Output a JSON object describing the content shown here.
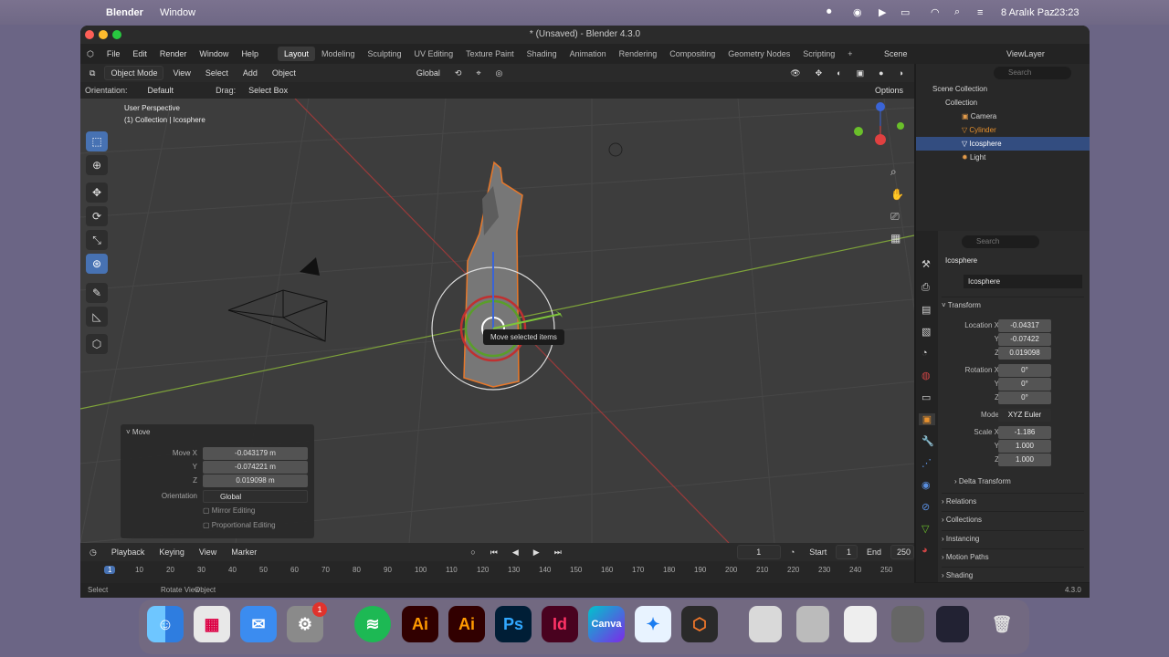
{
  "menubar": {
    "app": "Blender",
    "window": "Window",
    "date": "8 Aralık Paz",
    "time": "23:23"
  },
  "window": {
    "title": "* (Unsaved) - Blender 4.3.0"
  },
  "topmenu": {
    "file": "File",
    "edit": "Edit",
    "render": "Render",
    "window": "Window",
    "help": "Help"
  },
  "workspaces": [
    "Layout",
    "Modeling",
    "Sculpting",
    "UV Editing",
    "Texture Paint",
    "Shading",
    "Animation",
    "Rendering",
    "Compositing",
    "Geometry Nodes",
    "Scripting"
  ],
  "scene": {
    "name": "Scene",
    "viewlayer": "ViewLayer"
  },
  "viewport_header": {
    "mode": "Object Mode",
    "view": "View",
    "select": "Select",
    "add": "Add",
    "object": "Object",
    "transform": "Global"
  },
  "viewport_header2": {
    "orientation_label": "Orientation:",
    "orientation": "Default",
    "drag_label": "Drag:",
    "drag": "Select Box",
    "options": "Options"
  },
  "viewport": {
    "perspective": "User Perspective",
    "collection": "(1) Collection | Icosphere",
    "tooltip": "Move selected items"
  },
  "move_panel": {
    "title": "Move",
    "move_x_label": "Move X",
    "move_x": "-0.043179 m",
    "y_label": "Y",
    "y": "-0.074221 m",
    "z_label": "Z",
    "z": "0.019098 m",
    "orientation_label": "Orientation",
    "orientation": "Global",
    "mirror": "Mirror Editing",
    "proportional": "Proportional Editing"
  },
  "outliner": {
    "search_placeholder": "Search",
    "scene_collection": "Scene Collection",
    "collection": "Collection",
    "items": [
      "Camera",
      "Cylinder",
      "Icosphere",
      "Light"
    ]
  },
  "properties": {
    "search_placeholder": "Search",
    "object_name": "Icosphere",
    "data_name": "Icosphere",
    "transform": "Transform",
    "location_label": "Location X",
    "loc_x": "-0.04317",
    "loc_y": "-0.07422",
    "loc_z": "0.019098",
    "rotation_label": "Rotation X",
    "rot_x": "0°",
    "rot_y": "0°",
    "rot_z": "0°",
    "mode_label": "Mode",
    "mode": "XYZ Euler",
    "scale_label": "Scale X",
    "scale_x": "-1.186",
    "scale_y": "1.000",
    "scale_z": "1.000",
    "y_label": "Y",
    "z_label": "Z",
    "delta": "Delta Transform",
    "relations": "Relations",
    "collections": "Collections",
    "instancing": "Instancing",
    "motion_paths": "Motion Paths",
    "shading": "Shading"
  },
  "timeline": {
    "playback": "Playback",
    "keying": "Keying",
    "view": "View",
    "marker": "Marker",
    "current_frame": "1",
    "start_label": "Start",
    "start": "1",
    "end_label": "End",
    "end": "250",
    "ticks": [
      "1",
      "10",
      "20",
      "30",
      "40",
      "50",
      "60",
      "70",
      "80",
      "90",
      "100",
      "110",
      "120",
      "130",
      "140",
      "150",
      "160",
      "170",
      "180",
      "190",
      "200",
      "210",
      "220",
      "230",
      "240",
      "250"
    ]
  },
  "statusbar": {
    "select": "Select",
    "rotate": "Rotate View",
    "object": "Object",
    "version": "4.3.0"
  },
  "dock": {
    "badge": "1",
    "ai": "Ai",
    "ps": "Ps",
    "id": "Id",
    "canva": "Canva"
  }
}
